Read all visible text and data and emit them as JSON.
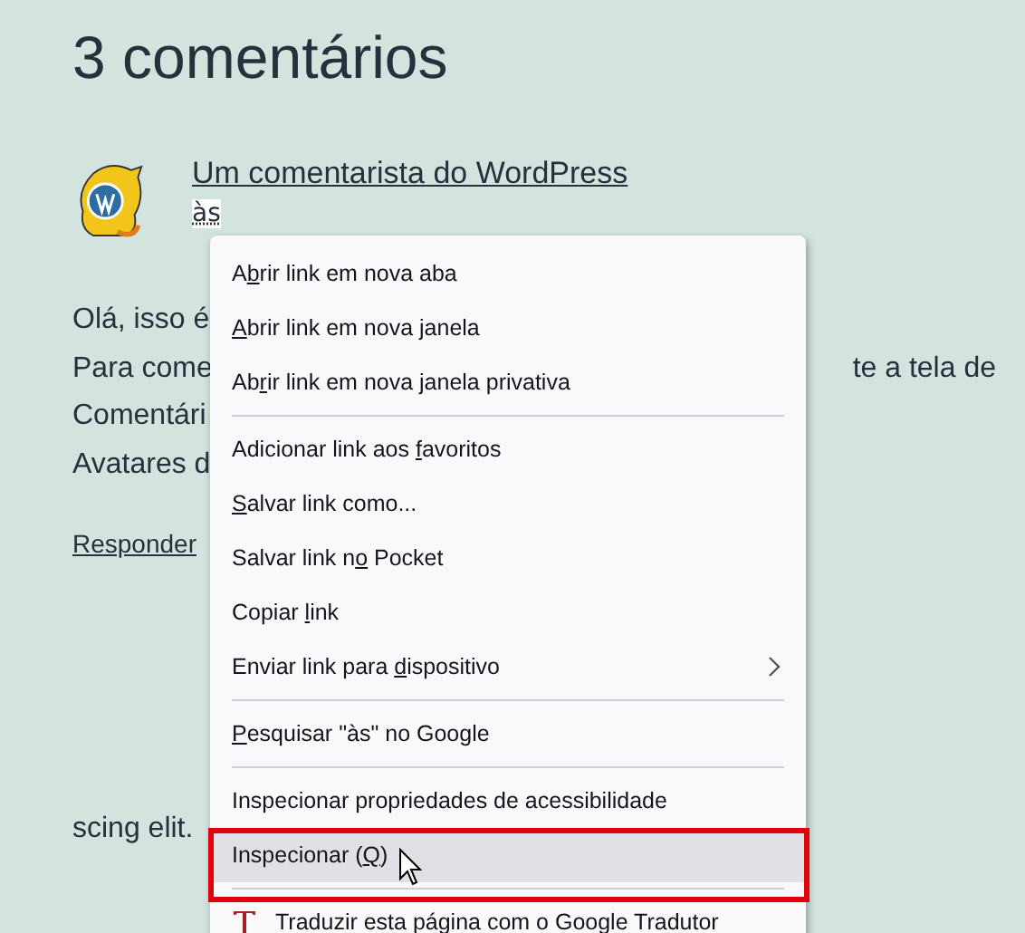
{
  "heading": "3 comentários",
  "comment": {
    "author": "Um comentarista do WordPress",
    "time": "às",
    "lines": [
      {
        "left": "Olá, isso é"
      },
      {
        "left": "Para come",
        "right": "te a tela de"
      },
      {
        "left": "Comentári"
      },
      {
        "left": "Avatares d"
      }
    ],
    "reply": "Responder"
  },
  "next_lines": [
    {
      "right": "scing elit."
    }
  ],
  "menu": {
    "items": [
      {
        "kind": "item",
        "pre": "A",
        "key": "b",
        "post": "rir link em nova aba",
        "selected": false
      },
      {
        "kind": "item",
        "key": "A",
        "post": "brir link em nova janela",
        "selected": false
      },
      {
        "kind": "item",
        "pre": "Ab",
        "key": "r",
        "post": "ir link em nova janela privativa",
        "selected": false
      },
      {
        "kind": "separator"
      },
      {
        "kind": "item",
        "pre": "Adicionar link aos ",
        "key": "f",
        "post": "avoritos",
        "selected": false
      },
      {
        "kind": "item",
        "key": "S",
        "post": "alvar link como...",
        "selected": false
      },
      {
        "kind": "item",
        "pre": "Salvar link n",
        "key": "o",
        "post": " Pocket",
        "selected": false
      },
      {
        "kind": "item",
        "pre": "Copiar ",
        "key": "l",
        "post": "ink",
        "selected": false
      },
      {
        "kind": "item",
        "pre": "Enviar link para ",
        "key": "d",
        "post": "ispositivo",
        "selected": false,
        "submenu": true
      },
      {
        "kind": "separator"
      },
      {
        "kind": "item",
        "key": "P",
        "post": "esquisar \"às\" no Google",
        "selected": false
      },
      {
        "kind": "separator"
      },
      {
        "kind": "item",
        "pre": "Inspecionar propriedades de acessibilidade",
        "selected": false
      },
      {
        "kind": "item",
        "pre": "Inspecionar (",
        "key": "Q",
        "post": ")",
        "selected": true,
        "annotated": true
      },
      {
        "kind": "separator"
      },
      {
        "kind": "icon_item",
        "pre": "Traduzir esta página com o Google Tradutor",
        "selected": false
      }
    ]
  }
}
